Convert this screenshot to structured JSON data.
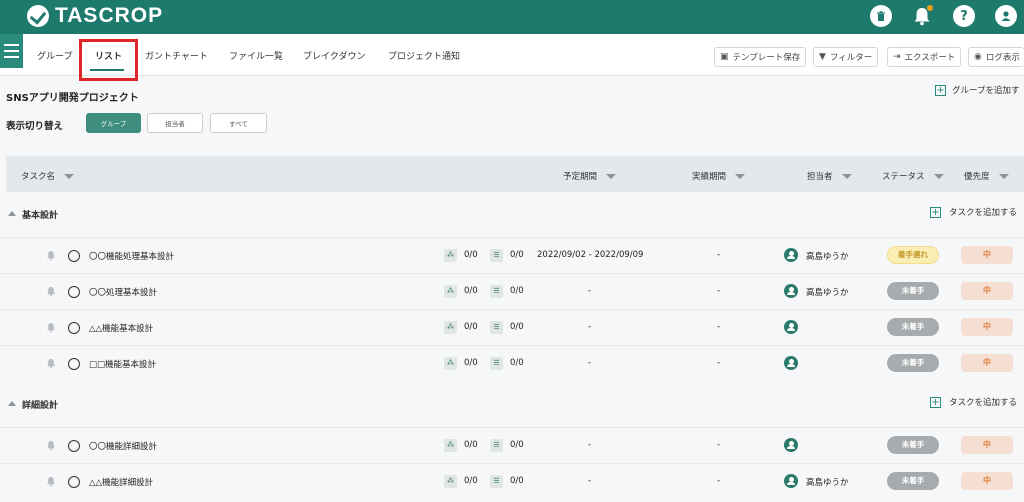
{
  "app": {
    "name": "TASCROP"
  },
  "header_icons": [
    "trash-icon",
    "bell-icon",
    "help-icon",
    "user-icon"
  ],
  "header_help_glyph": "?",
  "nav": {
    "tabs": [
      "グループ",
      "リスト",
      "ガントチャート",
      "ファイル一覧",
      "ブレイクダウン",
      "プロジェクト通知"
    ],
    "active_tab": "リスト"
  },
  "toolbar": {
    "template_save": "テンプレート保存",
    "filter": "フィルター",
    "export": "エクスポート",
    "log_display": "ログ表示"
  },
  "project": {
    "title": "SNSアプリ開発プロジェクト",
    "add_group": "グループを追加す"
  },
  "view_switch": {
    "label": "表示切り替え",
    "options": [
      "グループ",
      "担当者",
      "すべて"
    ],
    "selected": "グループ"
  },
  "columns": {
    "task_name": "タスク名",
    "planned_period": "予定期間",
    "actual_period": "実績期間",
    "assignee": "担当者",
    "status": "ステータス",
    "priority": "優先度"
  },
  "add_task_label": "タスクを追加する",
  "groups": [
    {
      "name": "基本設計",
      "tasks": [
        {
          "name": "〇〇機能処理基本設計",
          "subtask_count": "0/0",
          "checklist_count": "0/0",
          "planned": "2022/09/02 - 2022/09/09",
          "actual": "-",
          "assignee": "高島ゆうか",
          "status": "着手遅れ",
          "priority": "中"
        },
        {
          "name": "〇〇処理基本設計",
          "subtask_count": "0/0",
          "checklist_count": "0/0",
          "planned": "-",
          "actual": "-",
          "assignee": "高島ゆうか",
          "status": "未着手",
          "priority": "中"
        },
        {
          "name": "△△機能基本設計",
          "subtask_count": "0/0",
          "checklist_count": "0/0",
          "planned": "-",
          "actual": "-",
          "assignee": "",
          "status": "未着手",
          "priority": "中"
        },
        {
          "name": "□□機能基本設計",
          "subtask_count": "0/0",
          "checklist_count": "0/0",
          "planned": "-",
          "actual": "-",
          "assignee": "",
          "status": "未着手",
          "priority": "中"
        }
      ]
    },
    {
      "name": "詳細設計",
      "tasks": [
        {
          "name": "〇〇機能詳細設計",
          "subtask_count": "0/0",
          "checklist_count": "0/0",
          "planned": "-",
          "actual": "-",
          "assignee": "",
          "status": "未着手",
          "priority": "中"
        },
        {
          "name": "△△機能詳細設計",
          "subtask_count": "0/0",
          "checklist_count": "0/0",
          "planned": "-",
          "actual": "-",
          "assignee": "高島ゆうか",
          "status": "未着手",
          "priority": "中"
        }
      ]
    }
  ],
  "colors": {
    "brand": "#1f7a6e",
    "highlight_box": "#e0262a",
    "status_late_bg": "#fbeeb5",
    "status_default_bg": "#a7abae",
    "priority_bg": "#f4dfd2"
  }
}
